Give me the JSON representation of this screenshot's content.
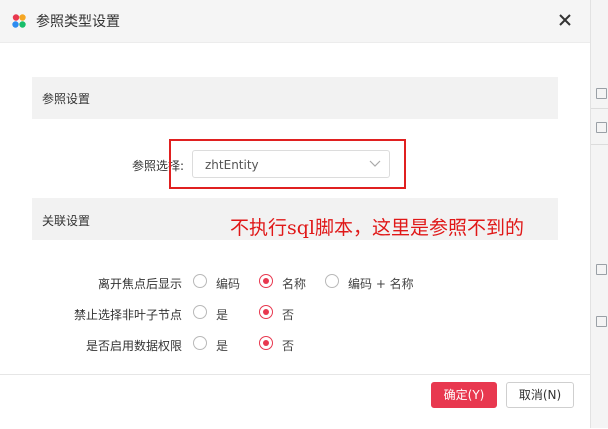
{
  "dialog": {
    "title": "参照类型设置",
    "logo_icon": "app-logo-icon",
    "close_icon": "close-icon"
  },
  "reference_section": {
    "title": "参照设置",
    "select_label": "参照选择:",
    "select_value": "zhtEntity",
    "caret_icon": "chevron-down-icon"
  },
  "related_section": {
    "title": "关联设置",
    "rows": [
      {
        "label": "离开焦点后显示",
        "options": [
          "编码",
          "名称",
          "编码 + 名称"
        ],
        "selected": "名称"
      },
      {
        "label": "禁止选择非叶子节点",
        "options": [
          "是",
          "否"
        ],
        "selected": "否"
      },
      {
        "label": "是否启用数据权限",
        "options": [
          "是",
          "否"
        ],
        "selected": "否"
      }
    ]
  },
  "annotation": "不执行sql脚本，这里是参照不到的",
  "footer": {
    "ok_label": "确定(Y)",
    "cancel_label": "取消(N)"
  },
  "colors": {
    "accent": "#e8384f",
    "annotation": "#e01818"
  }
}
